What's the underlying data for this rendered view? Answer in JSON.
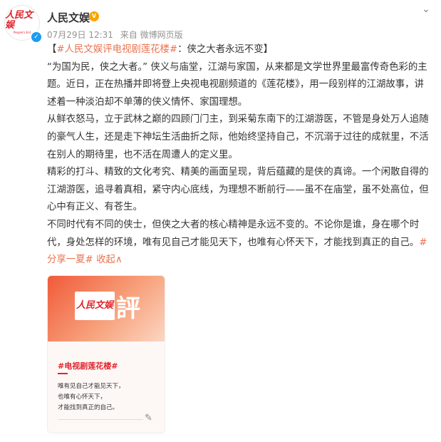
{
  "header": {
    "avatar_logo": "人民文娱",
    "avatar_sub": "People's Ent",
    "verified_icon": "✓",
    "username": "人民文娱",
    "vip_badge": "V",
    "date": "07月29日 12:31",
    "source": "来自 微博网页版",
    "more_icon": "⌄"
  },
  "post": {
    "para1_prefix": "【",
    "topic": "#人民文娱评电视剧莲花楼#",
    "para1_title": "：侠之大者永远不变】",
    "para2": "“为国为民，侠之大者。” 侠义与庙堂，江湖与家国，从来都是文学世界里最富传奇色彩的主题。近日，正在热播并即将登上央视电视剧频道的《莲花楼》，用一段别样的江湖故事，讲述着一种淡泊却不单薄的侠义情怀、家国理想。",
    "para3": "从鲜衣怒马，立于武林之巅的四顾门门主，到采菊东南下的江湖游医，不管是身处万人追随的豪气人生，还是走下神坛生活曲折之际，他始终坚持自己，不沉溺于过往的成就里，不活在别人的期待里，也不活在周遭人的定义里。",
    "para4": "精彩的打斗、精致的文化考究、精美的画面呈现，背后蕴藏的是侠的真谛。一个闲散自得的江湖游医，追寻着真相，紧守内心底线，为理想不断前行——虽不在庙堂，虽不处高位，但心中有正义、有苍生。",
    "para5": "不同时代有不同的侠士，但侠之大者的核心精神是永远不变的。不论你是谁，身在哪个时代，身处怎样的环境，唯有见自己才能见天下，也唯有心怀天下，才能找到真正的自己。",
    "hashtag2": "#分享一夏#",
    "collapse": "收起∧"
  },
  "card": {
    "logo": "人民文娱",
    "ping": "評",
    "tag": "#电视剧莲花楼#",
    "lines": [
      "唯有见自己才能见天下，",
      "也唯有心怀天下，",
      "才能找到真正的自己。"
    ],
    "pen_icon": "✎"
  },
  "colors": {
    "link": "#eb7350",
    "brand_red": "#e0232a",
    "verified": "#1d9bf0",
    "vip": "#f7a500"
  }
}
